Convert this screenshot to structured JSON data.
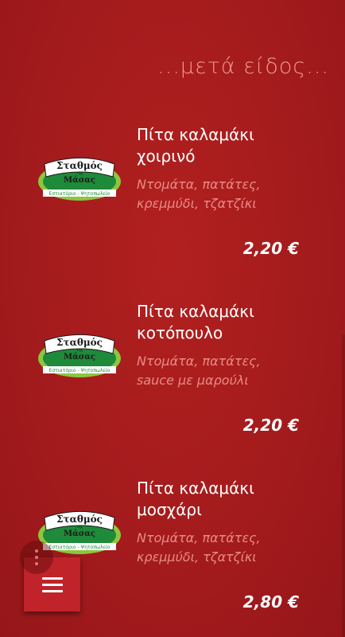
{
  "section": {
    "heading": "...μετά είδος..."
  },
  "logo": {
    "name": "Σταθμός",
    "sub": "της",
    "name2": "Μάσας",
    "tagline": "Εστιατόριο - Ψητοπωλείο"
  },
  "items": [
    {
      "title_line1": "Πίτα καλαμάκι",
      "title_line2": "χοιρινό",
      "desc_line1": "Ντομάτα, πατάτες,",
      "desc_line2": "κρεμμύδι, τζατζίκι",
      "price": "2,20 €"
    },
    {
      "title_line1": "Πίτα καλαμάκι",
      "title_line2": "κοτόπουλο",
      "desc_line1": "Ντομάτα, πατάτες,",
      "desc_line2": "sauce με μαρούλι",
      "price": "2,20 €"
    },
    {
      "title_line1": "Πίτα καλαμάκι",
      "title_line2": "μοσχάρι",
      "desc_line1": "Ντομάτα, πατάτες,",
      "desc_line2": "κρεμμύδι, τζατζίκι",
      "price": "2,80 €"
    }
  ],
  "icons": {
    "menu": "hamburger-icon",
    "more": "more-vert-icon"
  },
  "colors": {
    "background": "#a51c1f",
    "heading": "#f09a8f",
    "description": "#e88b85",
    "menu_button": "#c0232a"
  }
}
